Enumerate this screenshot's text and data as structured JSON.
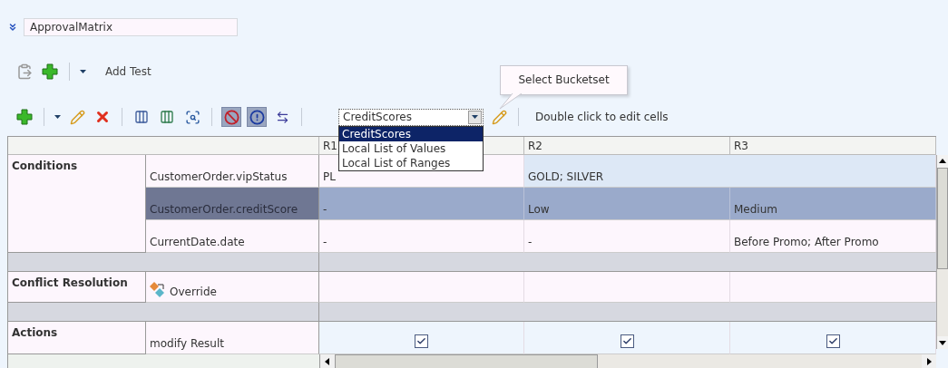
{
  "rule_name": {
    "value": "ApprovalMatrix"
  },
  "test_toolbar": {
    "label": "Add Test"
  },
  "table_toolbar": {
    "toggles": [
      {
        "pressed": true
      },
      {
        "pressed": true
      }
    ],
    "bucketset": {
      "value": "CreditScores",
      "open": true,
      "options": [
        {
          "label": "CreditScores",
          "selected": true
        },
        {
          "label": "Local List of Values",
          "selected": false
        },
        {
          "label": "Local List of Ranges",
          "selected": false
        }
      ]
    },
    "tooltip": "Select Bucketset",
    "hint": "Double click to edit cells"
  },
  "table": {
    "columns": [
      "R1",
      "R2",
      "R3"
    ],
    "sections": [
      {
        "label": "Conditions",
        "rows": [
          {
            "label": "CustomerOrder.vipStatus",
            "selected": false,
            "cells": [
              {
                "kind": "text",
                "text": "PL"
              },
              {
                "kind": "text",
                "text": "GOLD; SILVER",
                "spans_next": true
              }
            ]
          },
          {
            "label": "CustomerOrder.creditScore",
            "selected": true,
            "cells": [
              {
                "kind": "text",
                "text": "-"
              },
              {
                "kind": "text",
                "text": "Low"
              },
              {
                "kind": "text",
                "text": "Medium"
              }
            ]
          },
          {
            "label": "CurrentDate.date",
            "selected": false,
            "cells": [
              {
                "kind": "text",
                "text": "-"
              },
              {
                "kind": "text",
                "text": "-"
              },
              {
                "kind": "text",
                "text": "Before Promo; After Promo"
              }
            ]
          }
        ]
      },
      {
        "label": "Conflict Resolution",
        "rows": [
          {
            "label": "Override",
            "icon": true,
            "selected": false,
            "cells": [
              {
                "kind": "empty"
              },
              {
                "kind": "empty"
              },
              {
                "kind": "empty"
              }
            ]
          }
        ]
      },
      {
        "label": "Actions",
        "rows": [
          {
            "label": "modify Result",
            "selected": false,
            "cells": [
              {
                "kind": "checkbox",
                "checked": true
              },
              {
                "kind": "checkbox",
                "checked": true
              },
              {
                "kind": "checkbox",
                "checked": true
              }
            ]
          }
        ]
      }
    ]
  }
}
